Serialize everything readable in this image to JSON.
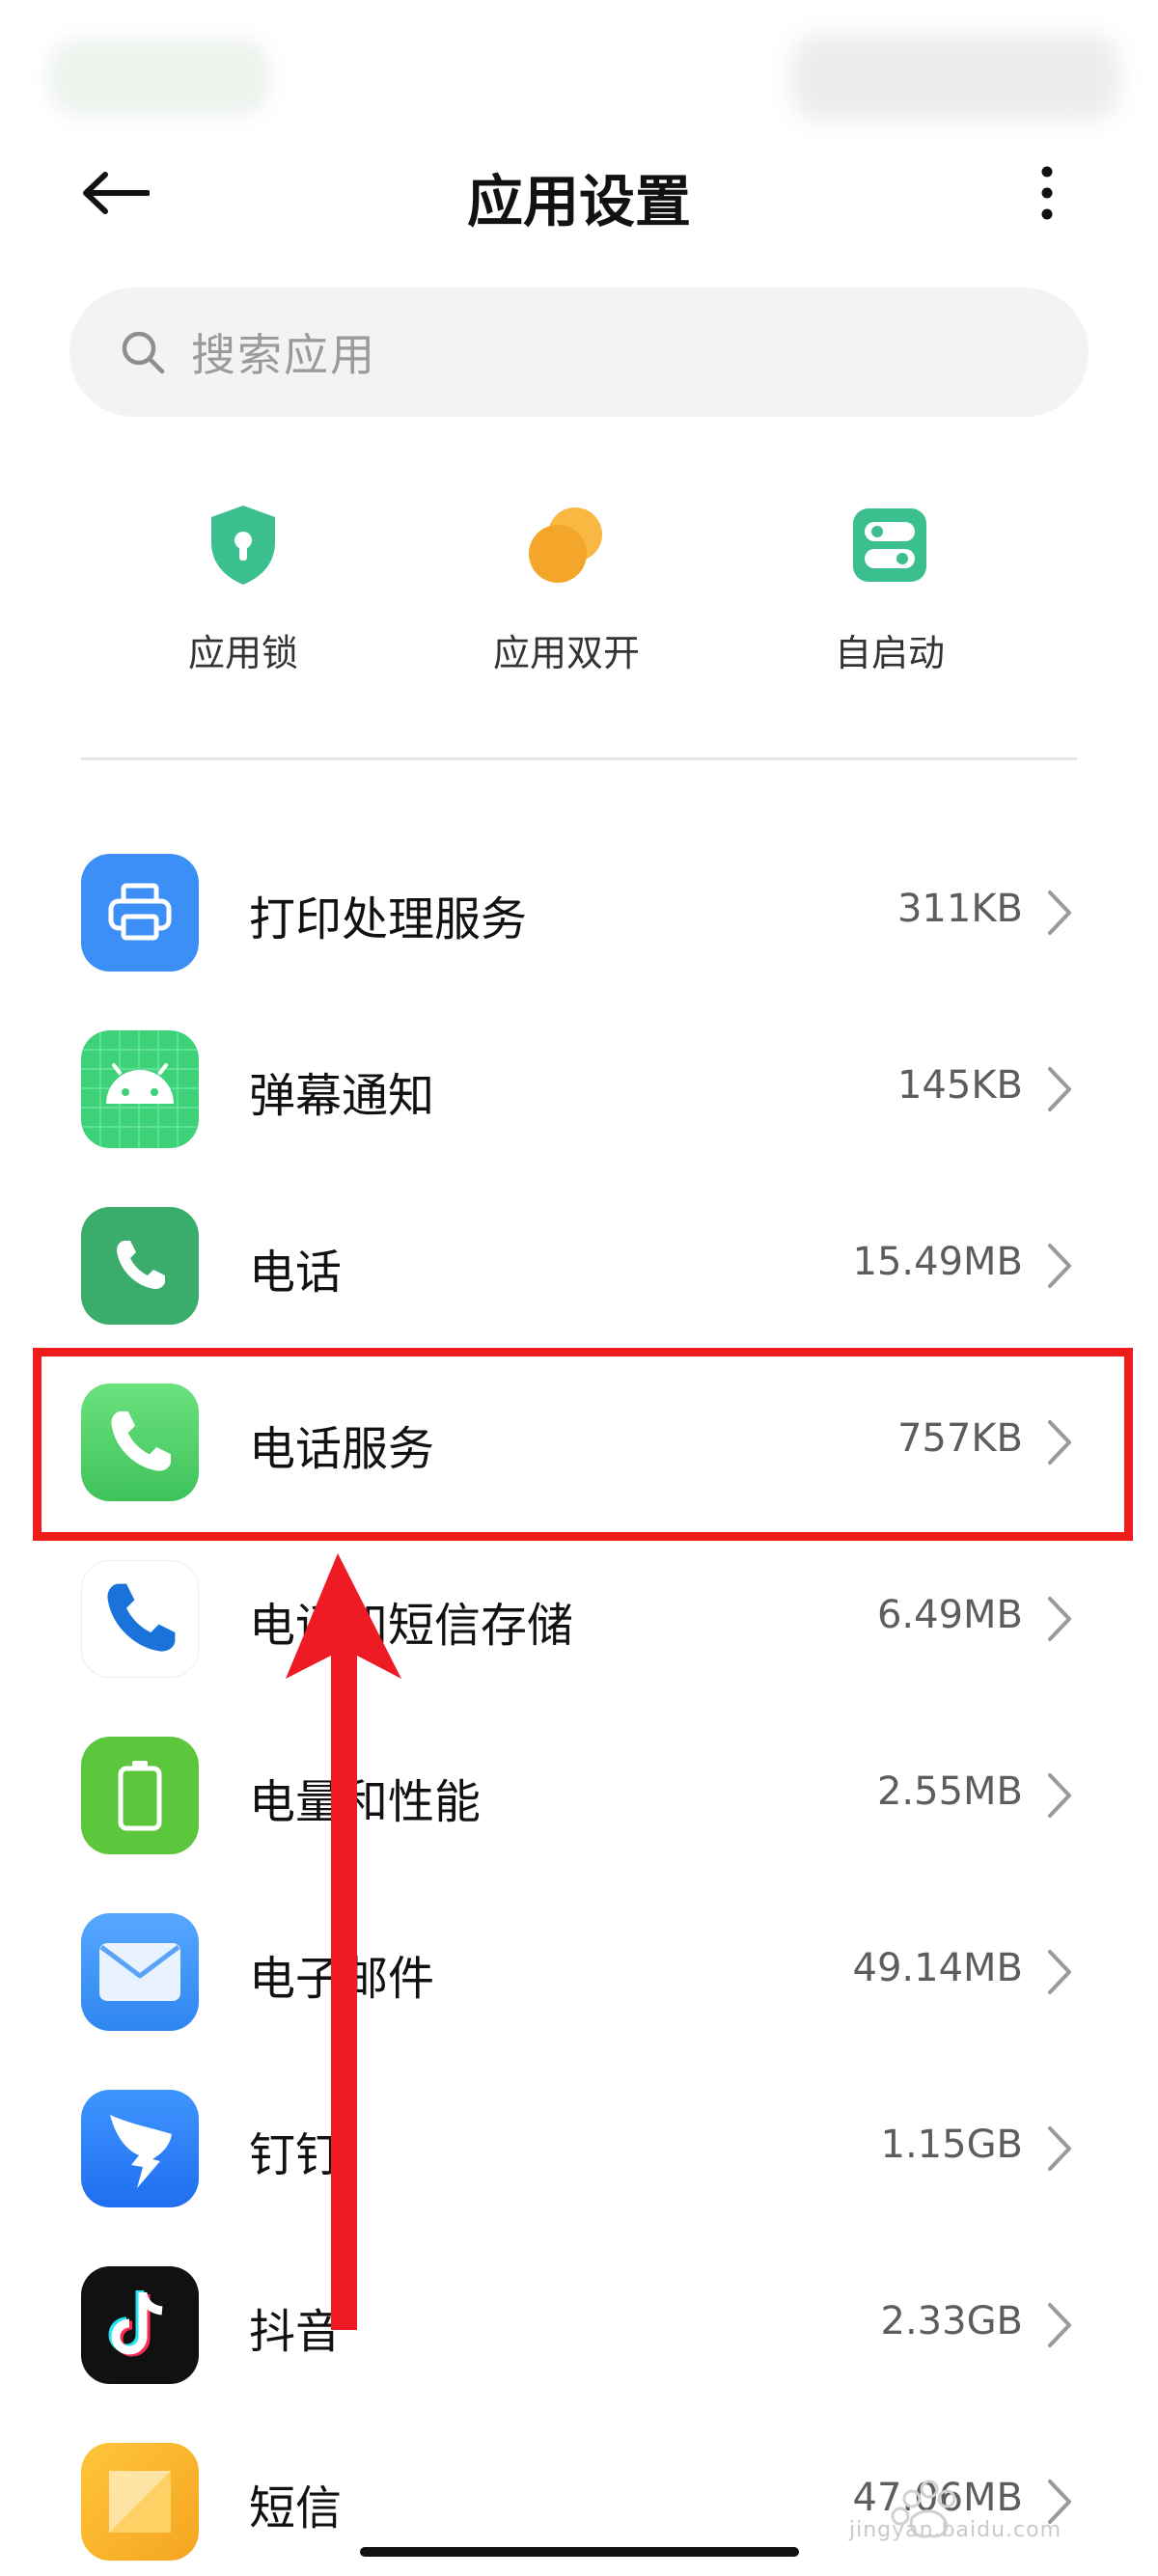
{
  "header": {
    "title": "应用设置"
  },
  "search": {
    "placeholder": "搜索应用"
  },
  "shortcuts": [
    {
      "label": "应用锁",
      "icon": "shield-lock-icon",
      "color": "#3cbf8f"
    },
    {
      "label": "应用双开",
      "icon": "dual-circle-icon",
      "color": "#f5a623"
    },
    {
      "label": "自启动",
      "icon": "toggle-switch-icon",
      "color": "#3cbf8f"
    }
  ],
  "apps": [
    {
      "name": "打印处理服务",
      "size": "311KB",
      "icon": "printer-icon"
    },
    {
      "name": "弹幕通知",
      "size": "145KB",
      "icon": "android-icon"
    },
    {
      "name": "电话",
      "size": "15.49MB",
      "icon": "phone-icon"
    },
    {
      "name": "电话服务",
      "size": "757KB",
      "icon": "phone-service-icon"
    },
    {
      "name": "电话和短信存储",
      "size": "6.49MB",
      "icon": "phone-storage-icon"
    },
    {
      "name": "电量和性能",
      "size": "2.55MB",
      "icon": "battery-icon"
    },
    {
      "name": "电子邮件",
      "size": "49.14MB",
      "icon": "mail-icon"
    },
    {
      "name": "钉钉",
      "size": "1.15GB",
      "icon": "dingtalk-icon"
    },
    {
      "name": "抖音",
      "size": "2.33GB",
      "icon": "douyin-icon"
    },
    {
      "name": "短信",
      "size": "47.06MB",
      "icon": "messages-icon"
    }
  ],
  "watermark": {
    "text": "jingyan.baidu.com"
  },
  "colors": {
    "highlight": "#ef1c1c",
    "arrow": "#ee1b24"
  }
}
